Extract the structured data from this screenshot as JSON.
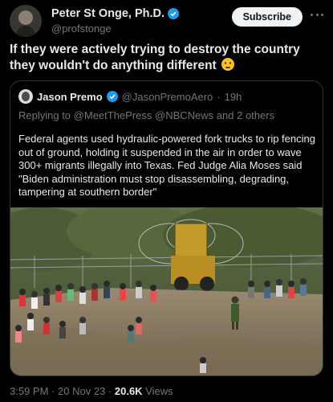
{
  "author": {
    "name": "Peter St Onge, Ph.D.",
    "handle": "@profstonge",
    "avatar_icon": "profile-photo-icon",
    "verified_icon": "verified-badge-icon",
    "verified_color": "#1d9bf0"
  },
  "header": {
    "subscribe_label": "Subscribe",
    "more_icon": "more-options-icon"
  },
  "tweet": {
    "text": "If they were actively trying to destroy the country they wouldn't do anything different",
    "emoji_icon": "thinking-face-emoji-icon"
  },
  "quote": {
    "author_name": "Jason Premo",
    "handle": "@JasonPremoAero",
    "separator": "·",
    "time": "19h",
    "reply_prefix": "Replying to",
    "reply_mentions": "@MeetThePress @NBCNews",
    "reply_suffix": "and 2 others",
    "text": "Federal agents used hydraulic-powered fork trucks to rip fencing out of ground, holding it suspended in the air in order to wave 300+ migrants illegally into Texas. Fed Judge Alia Moses said \"Biden administration must stop disassembling, degrading, tampering at southern border\"",
    "media_icon": "border-fence-photo"
  },
  "footer": {
    "time": "3:59 PM",
    "separator": "·",
    "date": "20 Nov 23",
    "views_separator": "·",
    "views_count": "20.6K",
    "views_label": "Views"
  },
  "colors": {
    "background": "#000000",
    "text_primary": "#e7e9ea",
    "text_secondary": "#71767b",
    "border": "#2f3336",
    "subscribe_bg": "#eff3f4"
  }
}
